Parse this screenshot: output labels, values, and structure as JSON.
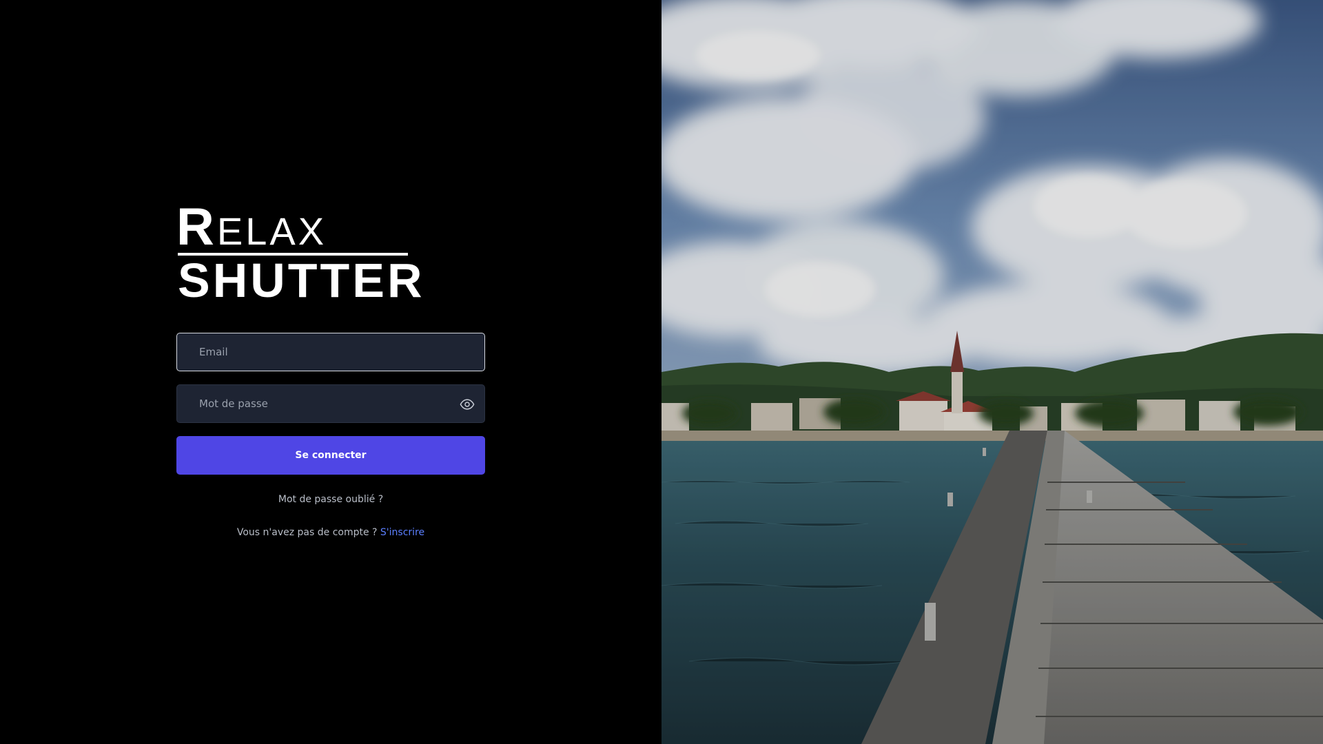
{
  "logo": {
    "relax_initial": "R",
    "relax_rest": "ELAX",
    "shutter": "SHUTTER"
  },
  "form": {
    "email": {
      "placeholder": "Email",
      "value": ""
    },
    "password": {
      "placeholder": "Mot de passe",
      "value": ""
    },
    "show_password_icon": "eye-icon",
    "submit_label": "Se connecter",
    "forgot_label": "Mot de passe oublié ?",
    "signup_prompt": "Vous n'avez pas de compte ?",
    "signup_link": "S'inscrire"
  },
  "colors": {
    "background": "#000000",
    "input_background": "#1e2433",
    "primary_button": "#4f46e5",
    "link": "#5b7fff"
  },
  "hero_image": {
    "subject": "pier-with-village-and-hills"
  }
}
